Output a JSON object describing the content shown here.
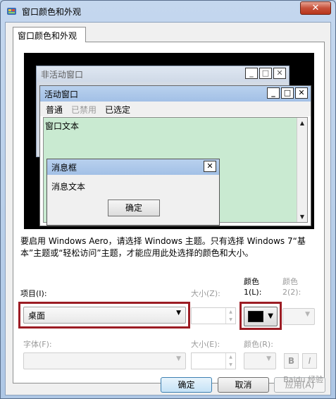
{
  "window": {
    "title": "窗口颜色和外观",
    "close_glyph": "✕",
    "app_icon": "paint-palette-icon"
  },
  "tab": {
    "label": "窗口颜色和外观"
  },
  "preview": {
    "inactive_title": "非活动窗口",
    "active_title": "活动窗口",
    "menu": {
      "normal": "普通",
      "disabled": "已禁用",
      "selected": "已选定"
    },
    "window_text": "窗口文本",
    "msgbox_title": "消息框",
    "msgbox_text": "消息文本",
    "ok_label": "确定",
    "caption_buttons": {
      "minimize": "_",
      "maximize": "□",
      "close": "✕"
    },
    "scroll_up": "▲",
    "scroll_down": "▼",
    "colors": {
      "inactive_title": "#d4dbe5",
      "active_title": "#a9c5ea",
      "window_bg": "#c9ead1",
      "desktop": "#000000"
    }
  },
  "description": "要启用 Windows Aero，请选择 Windows 主题。只有选择 Windows 7“基本”主题或“轻松访问”主题，才能应用此处选择的颜色和大小。",
  "item": {
    "label": "项目(I):",
    "value": "桌面",
    "arrow": "▼"
  },
  "size1": {
    "label": "大小(Z):"
  },
  "color1": {
    "label_line1": "颜色",
    "label_line2": "1(L):",
    "swatch": "#000000",
    "arrow": "▼"
  },
  "color2": {
    "label_line1": "颜色",
    "label_line2": "2(2):",
    "arrow": "▼"
  },
  "font": {
    "label": "字体(F):",
    "arrow": "▼"
  },
  "size2": {
    "label": "大小(E):"
  },
  "fontcolor": {
    "label": "颜色(R):",
    "arrow": "▼"
  },
  "bold": "B",
  "italic": "I",
  "buttons": {
    "ok": "确定",
    "cancel": "取消",
    "apply": "应用(A)"
  },
  "spin": {
    "up": "▲",
    "down": "▼"
  },
  "highlight_color": "#9c1c24",
  "watermark": "Baidu 经验"
}
